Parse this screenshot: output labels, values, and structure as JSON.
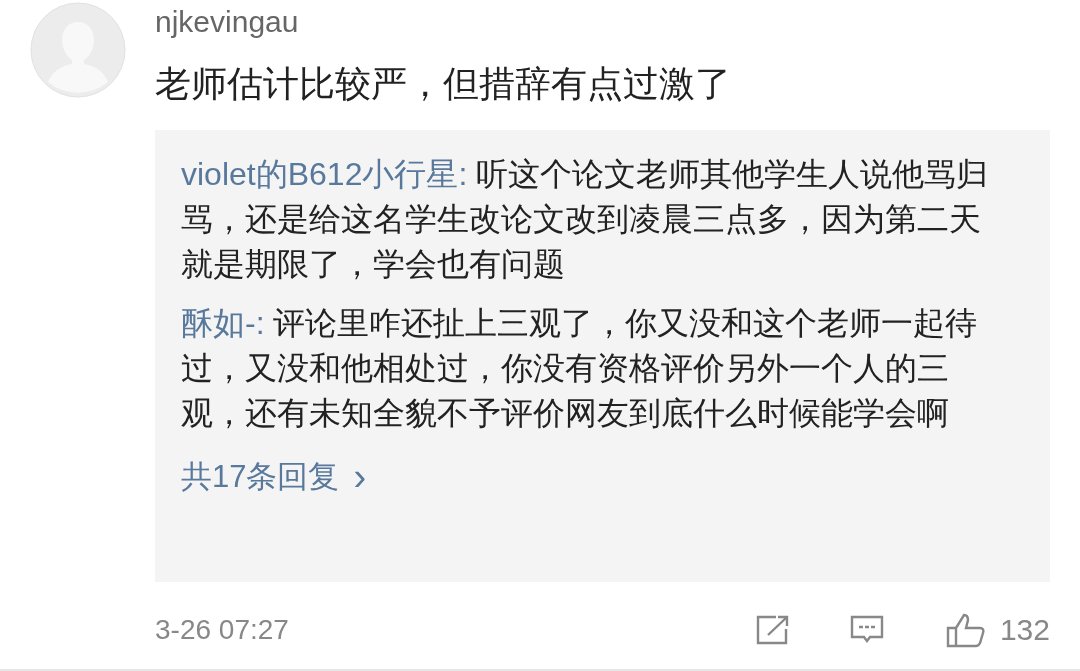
{
  "comment": {
    "username": "njkevingau",
    "text": "老师估计比较严，但措辞有点过激了",
    "replies": [
      {
        "author": "violet的B612小行星:",
        "text": "听这个论文老师其他学生人说他骂归骂，还是给这名学生改论文改到凌晨三点多，因为第二天就是期限了，学会也有问题"
      },
      {
        "author": "酥如-:",
        "text": "评论里咋还扯上三观了，你又没和这个老师一起待过，又没和他相处过，你没有资格评价另外一个人的三观，还有未知全貌不予评价网友到底什么时候能学会啊"
      }
    ],
    "more_replies": "共17条回复",
    "more_arrow": "›",
    "time": "3-26 07:27",
    "like_count": "132"
  }
}
